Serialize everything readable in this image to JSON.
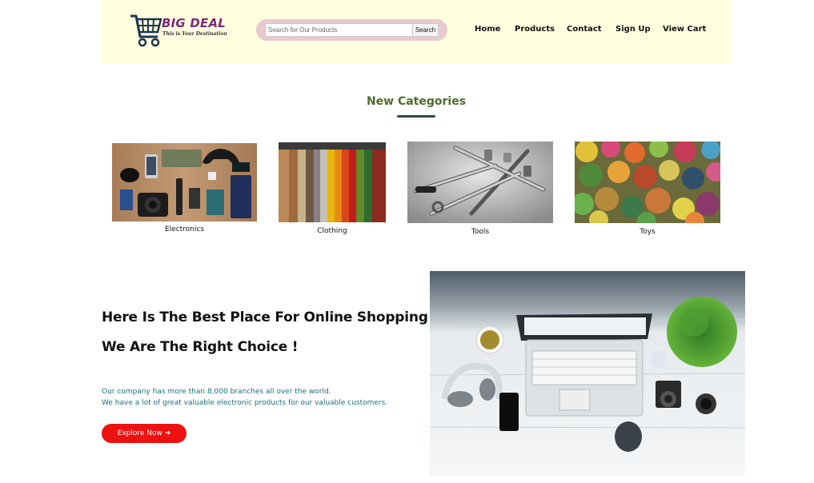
{
  "brand": {
    "name": "BIG DEAL",
    "tagline": "This is Your Destination"
  },
  "search": {
    "placeholder": "Search for Our Products",
    "button_label": "Search"
  },
  "nav": {
    "items": [
      "Home",
      "Products",
      "Contact",
      "Sign Up",
      "View Cart"
    ]
  },
  "categories": {
    "title": "New Categories",
    "items": [
      {
        "label": "Electronics"
      },
      {
        "label": "Clothing"
      },
      {
        "label": "Tools"
      },
      {
        "label": "Toys"
      }
    ]
  },
  "hero": {
    "headline_1": "Here Is The Best Place For Online Shopping",
    "headline_2": "We Are The Right Choice !",
    "text_1": "Our company has more than 8,000 branches all over the world.",
    "text_2": "We have a lot of great valuable electronic products for our valuable customers.",
    "button_label": "Explore Now ➔"
  },
  "colors": {
    "header_bg": "#ffffe0",
    "search_pill": "#e9c9cf",
    "title_green": "#4f6b2a",
    "text_teal": "#1a6f7a",
    "button_red": "#ee1111"
  }
}
